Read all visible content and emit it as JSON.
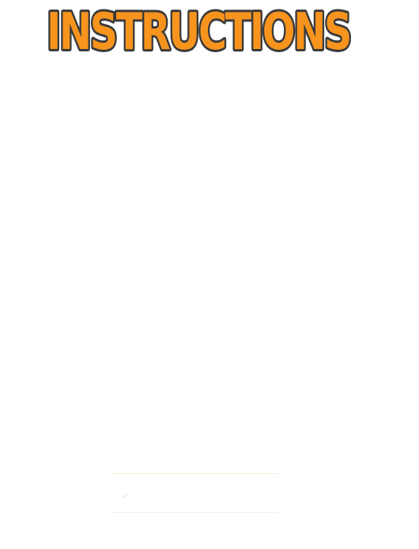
{
  "title": {
    "text": "INSTRUCTIONS",
    "fill_color": "#f7941d",
    "outline_color": "#3a3a3a"
  },
  "colors": {
    "background": "#ffffff",
    "button_border": "#eef1d9"
  }
}
